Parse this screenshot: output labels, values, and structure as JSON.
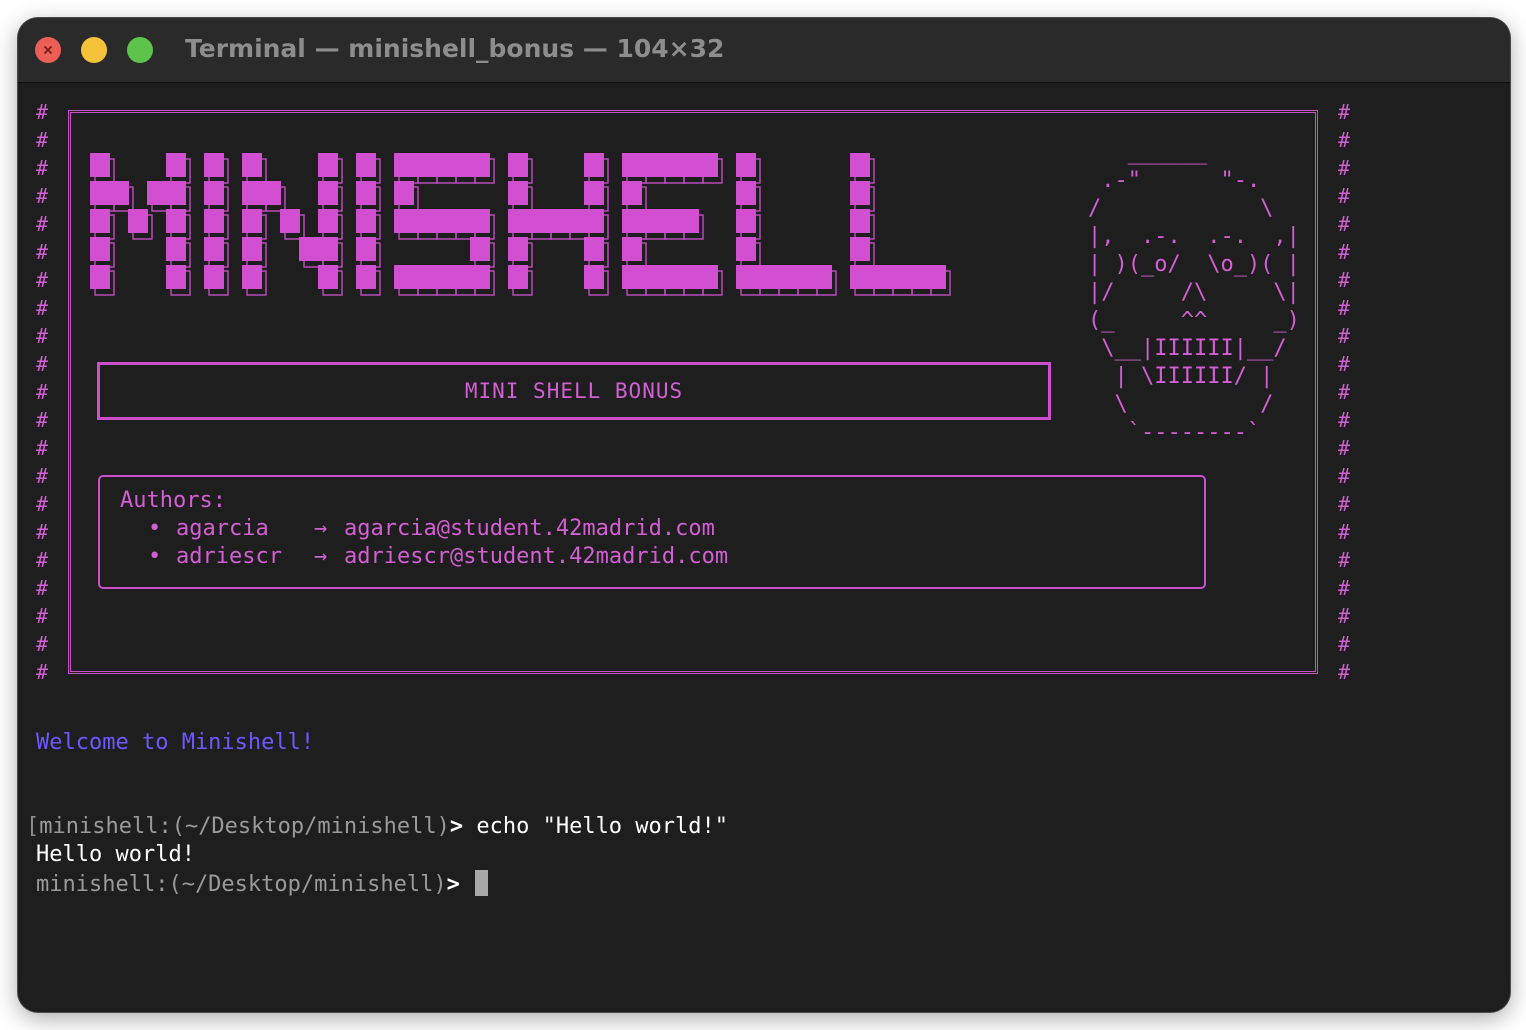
{
  "window": {
    "title": "Terminal — minishell_bonus — 104×32"
  },
  "banner": {
    "hash": "#",
    "logo_text": "MINISHELL",
    "subtitle": "MINI SHELL BONUS",
    "skull_ascii": "   ______\n .-\"      \"-.\n/            \\\n|,  .-.  .-.  ,|\n| )(_o/  \\o_)( |\n|/     /\\     \\|\n(_     ^^     _)\n \\__|IIIIII|__/\n  | \\IIIIII/ |\n  \\          /\n   `--------`",
    "authors_title": "Authors:",
    "authors": [
      {
        "bullet": "•",
        "name": "agarcia",
        "arrow": "→",
        "email": "agarcia@student.42madrid.com"
      },
      {
        "bullet": "•",
        "name": "adriescr",
        "arrow": "→",
        "email": "adriescr@student.42madrid.com"
      }
    ]
  },
  "session": {
    "welcome": "Welcome to Minishell!",
    "prompt": "minishell:(~/Desktop/minishell)",
    "prompt_bracket": "[",
    "prompt_symbol": ">",
    "command": "echo \"Hello world!\"",
    "output": "Hello world!"
  },
  "colors": {
    "background": "#1e1e1e",
    "accent": "#d45ed4",
    "welcome": "#6b58ff",
    "prompt": "#9a9a9a"
  },
  "icons": {
    "close": "close-light-icon",
    "minimize": "minimize-light-icon",
    "zoom": "zoom-light-icon"
  }
}
